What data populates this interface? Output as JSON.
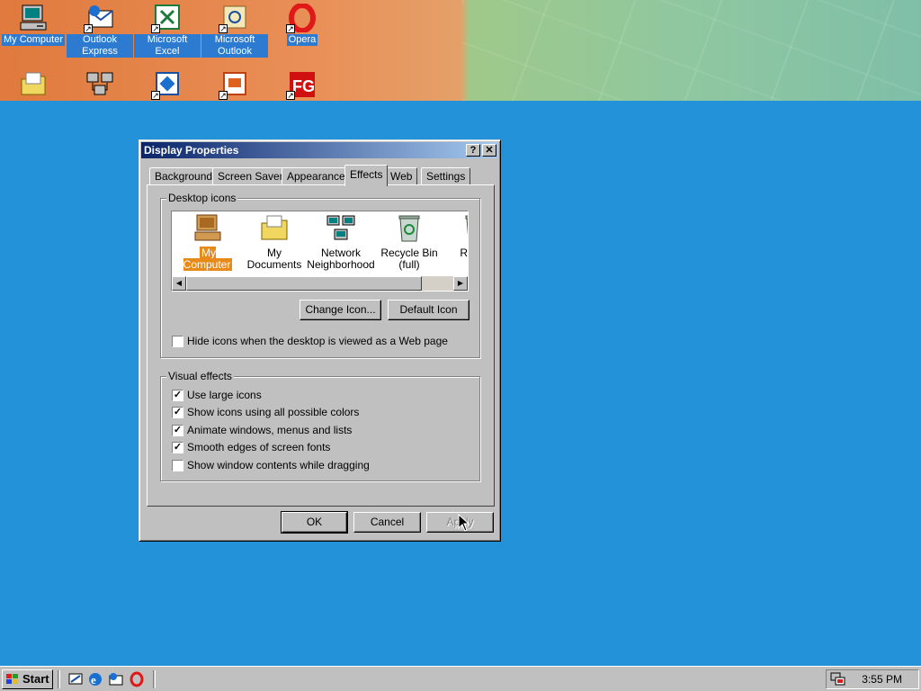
{
  "desktop": {
    "icons_top": [
      {
        "label": "My Computer",
        "icon": "my-computer-icon"
      },
      {
        "label": "Outlook Express",
        "icon": "outlook-express-icon"
      },
      {
        "label": "Microsoft Excel",
        "icon": "excel-icon"
      },
      {
        "label": "Microsoft Outlook",
        "icon": "outlook-icon"
      },
      {
        "label": "Opera",
        "icon": "opera-icon"
      }
    ],
    "icons_bottom": [
      {
        "icon": "my-documents-icon"
      },
      {
        "icon": "network-neighborhood-icon"
      },
      {
        "icon": "shortcut-app-icon"
      },
      {
        "icon": "powerpoint-icon"
      },
      {
        "icon": "fg-app-icon"
      }
    ],
    "background_color": "#2492d9"
  },
  "dialog": {
    "title": "Display Properties",
    "help_button": "?",
    "close_button": "✕",
    "tabs": [
      {
        "label": "Background"
      },
      {
        "label": "Screen Saver"
      },
      {
        "label": "Appearance"
      },
      {
        "label": "Effects",
        "active": true
      },
      {
        "label": "Web"
      },
      {
        "label": "Settings"
      }
    ],
    "desktop_icons": {
      "legend": "Desktop icons",
      "items": [
        {
          "label": "My Computer",
          "icon": "my-computer-icon",
          "selected": true
        },
        {
          "label": "My Documents",
          "icon": "my-documents-icon"
        },
        {
          "label": "Network Neighborhood",
          "icon": "network-neighborhood-icon"
        },
        {
          "label": "Recycle Bin (full)",
          "icon": "recycle-bin-full-icon"
        },
        {
          "label": "Rec (e",
          "icon": "recycle-bin-empty-icon"
        }
      ],
      "change_icon_button": "Change Icon...",
      "default_icon_button": "Default Icon",
      "hide_icons_label": "Hide icons when the desktop is viewed as a Web page",
      "hide_icons_checked": false
    },
    "visual_effects": {
      "legend": "Visual effects",
      "options": [
        {
          "label": "Use large icons",
          "checked": true
        },
        {
          "label": "Show icons using all possible colors",
          "checked": true
        },
        {
          "label": "Animate windows, menus and lists",
          "checked": true
        },
        {
          "label": "Smooth edges of screen fonts",
          "checked": true
        },
        {
          "label": "Show window contents while dragging",
          "checked": false
        }
      ]
    },
    "buttons": {
      "ok": "OK",
      "cancel": "Cancel",
      "apply": "Apply"
    }
  },
  "taskbar": {
    "start_label": "Start",
    "quick_launch": [
      "show-desktop-icon",
      "internet-explorer-icon",
      "outlook-express-icon",
      "opera-icon"
    ],
    "clock": "3:55 PM"
  }
}
